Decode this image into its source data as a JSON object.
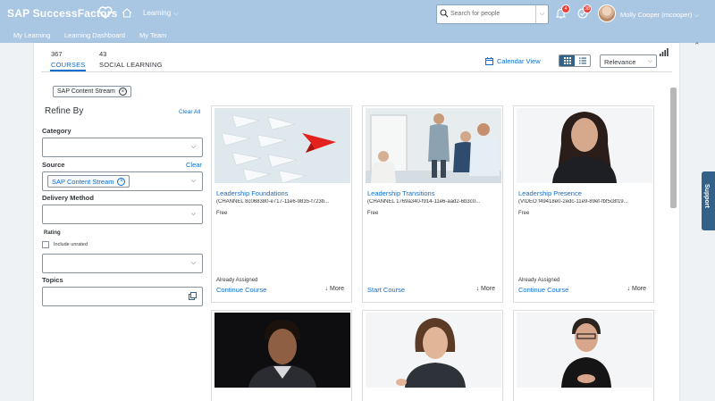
{
  "shell": {
    "brand": "SAP SuccessFactors",
    "module_menu": "Learning",
    "search_placeholder": "Search for people",
    "notification_count": "4",
    "todo_count": "38",
    "user_name": "Molly Cooper (mcooper)",
    "subnav": [
      "My Learning",
      "Learning Dashboard",
      "My Team"
    ]
  },
  "tabs": [
    {
      "count": "367",
      "label": "COURSES",
      "active": true
    },
    {
      "count": "43",
      "label": "SOCIAL LEARNING",
      "active": false
    }
  ],
  "toolbar": {
    "calendar_view": "Calendar View",
    "sort_value": "Relevance"
  },
  "active_filter": "SAP Content Stream",
  "refine": {
    "title": "Refine By",
    "clear_all": "Clear All",
    "category_label": "Category",
    "source_label": "Source",
    "source_clear": "Clear",
    "source_value": "SAP Content Stream",
    "delivery_label": "Delivery Method",
    "rating_label": "Rating",
    "include_unrated": "Include unrated",
    "topics_label": "Topics"
  },
  "courses": [
    {
      "title": "Leadership Foundations",
      "id": "(CHANNEL 8c068380-e717-11e6-9835-f723b...",
      "price": "Free",
      "status": "Already Assigned",
      "action": "Continue Course",
      "more": "More"
    },
    {
      "title": "Leadership Transitions",
      "id": "(CHANNEL 1769a340-f914-11e6-aad2-6b3c0...",
      "price": "Free",
      "status": "",
      "action": "Start Course",
      "more": "More"
    },
    {
      "title": "Leadership Presence",
      "id": "(VIDEO f49418e0-2edc-11e9-89ef-fbf5c8f19...",
      "price": "Free",
      "status": "Already Assigned",
      "action": "Continue Course",
      "more": "More"
    }
  ],
  "support_label": "Support",
  "icons": {
    "brand_heart": "heart-icon",
    "home": "home-icon",
    "search": "search-icon",
    "bell": "bell-icon",
    "todo": "check-circle-icon",
    "calendar": "calendar-icon",
    "grid": "grid-view-icon",
    "list": "list-view-icon",
    "chart": "bar-chart-icon",
    "popup": "value-help-icon",
    "more": "down-arrow-icon"
  },
  "colors": {
    "shell": "#a9c7e2",
    "link": "#0a6ed1",
    "toggle_active": "#346187",
    "badge": "#e9403a"
  }
}
